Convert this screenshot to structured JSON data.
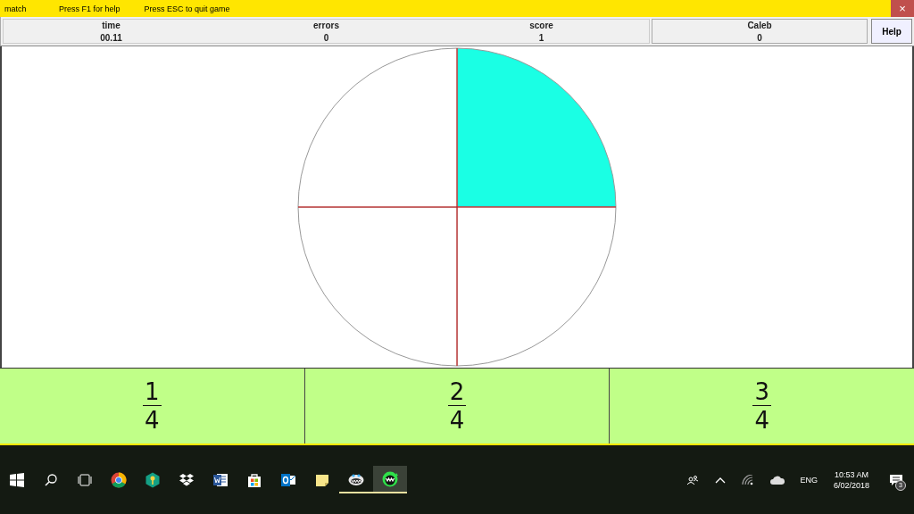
{
  "title_bar": {
    "title": "match",
    "hints": [
      "Press F1 for help",
      "Press ESC to quit game"
    ],
    "close": "×"
  },
  "stats": [
    {
      "label": "time",
      "value": "00.11"
    },
    {
      "label": "errors",
      "value": "0"
    },
    {
      "label": "score",
      "value": "1"
    }
  ],
  "player": {
    "name": "Caleb",
    "value": "0"
  },
  "help_button": "Help",
  "pie": {
    "slices": [
      {
        "filled": true
      },
      {
        "filled": false
      },
      {
        "filled": false
      },
      {
        "filled": false
      }
    ]
  },
  "answers": [
    {
      "numerator": "1",
      "denominator": "4"
    },
    {
      "numerator": "2",
      "denominator": "4"
    },
    {
      "numerator": "3",
      "denominator": "4"
    }
  ],
  "taskbar": {
    "apps": [
      {
        "kind": "chrome",
        "running": false,
        "selected": false
      },
      {
        "kind": "key",
        "running": false,
        "selected": false
      },
      {
        "kind": "dropbox",
        "running": false,
        "selected": false
      },
      {
        "kind": "word",
        "running": false,
        "selected": false
      },
      {
        "kind": "store",
        "running": false,
        "selected": false
      },
      {
        "kind": "outlook",
        "running": false,
        "selected": false
      },
      {
        "kind": "notes",
        "running": false,
        "selected": false
      },
      {
        "kind": "creature",
        "running": true,
        "selected": false
      },
      {
        "kind": "monster",
        "running": true,
        "selected": true
      }
    ],
    "language": "ENG",
    "time": "10:53 AM",
    "date": "6/02/2018",
    "notifications": "3"
  }
}
